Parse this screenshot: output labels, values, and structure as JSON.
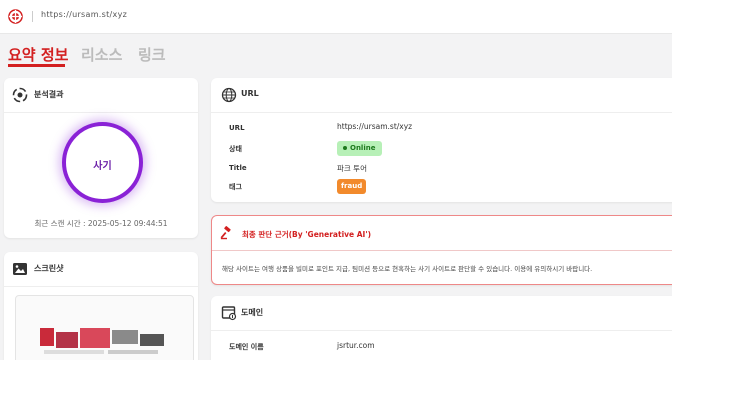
{
  "topbar": {
    "url_text": "https://ursam.st/xyz"
  },
  "tabs": [
    {
      "label": "요약 정보",
      "active": true
    },
    {
      "label": "리소스",
      "active": false
    },
    {
      "label": "링크",
      "active": false
    }
  ],
  "analysis": {
    "title": "분석결과",
    "result": "사기",
    "scan_time": "최근 스캔 시간 : 2025-05-12 09:44:51"
  },
  "screenshot": {
    "title": "스크린샷"
  },
  "url_card": {
    "title": "URL",
    "fields": [
      {
        "label": "URL",
        "value": "https://ursam.st/xyz"
      },
      {
        "label": "상태",
        "value": "Online"
      },
      {
        "label": "Title",
        "value": "파크 투어"
      },
      {
        "label": "태그",
        "value": "fraud"
      }
    ]
  },
  "verdict": {
    "title": "최종 판단 근거(By 'Generative AI')",
    "body": "해당 사이트는 여행 상품을 빌미로 포인트 지급, 팀미션 등으로 현혹하는 사기 사이트로 판단할 수 있습니다. 이용에 유의하시기 바랍니다."
  },
  "domain_card": {
    "title": "도메인",
    "field_label": "도메인 이름",
    "field_value": "jsrtur.com"
  },
  "colors": {
    "accent": "#d32020",
    "fraud_ring": "#8a22d6",
    "online_bg": "#b7f0b7",
    "tag_bg": "#f28a2c"
  },
  "icons": [
    "logo-icon",
    "analysis-icon",
    "image-icon",
    "globe-icon",
    "gavel-icon",
    "domain-icon"
  ]
}
